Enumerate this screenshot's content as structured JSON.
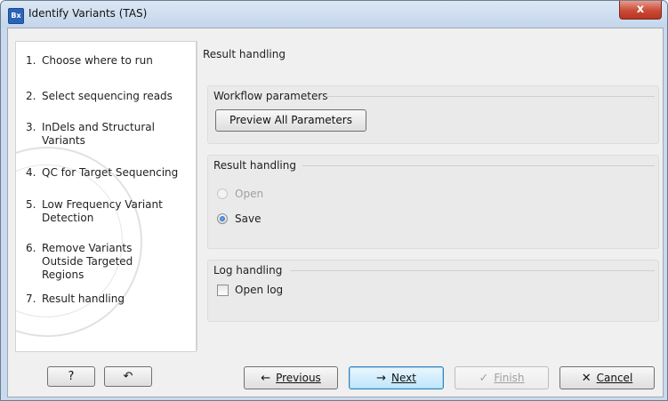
{
  "window": {
    "title": "Identify Variants (TAS)",
    "app_icon_text": "Bx",
    "close_glyph": "x"
  },
  "steps": [
    {
      "num": "1.",
      "label": "Choose where to run"
    },
    {
      "num": "2.",
      "label": "Select sequencing reads"
    },
    {
      "num": "3.",
      "label": "InDels and Structural Variants"
    },
    {
      "num": "4.",
      "label": "QC for Target Sequencing"
    },
    {
      "num": "5.",
      "label": "Low Frequency Variant Detection"
    },
    {
      "num": "6.",
      "label": "Remove Variants Outside Targeted Regions"
    },
    {
      "num": "7.",
      "label": "Result handling"
    }
  ],
  "content": {
    "heading": "Result handling",
    "workflow_params": {
      "title": "Workflow parameters",
      "preview_button": "Preview All Parameters"
    },
    "result_handling": {
      "title": "Result handling",
      "open_label": "Open",
      "save_label": "Save",
      "selected": "Save",
      "open_enabled": false
    },
    "log_handling": {
      "title": "Log handling",
      "open_log_label": "Open log",
      "open_log_checked": false
    }
  },
  "footer": {
    "help_glyph": "?",
    "reset_glyph": "↶",
    "previous_label": "Previous",
    "previous_icon": "←",
    "next_label": "Next",
    "next_icon": "→",
    "finish_label": "Finish",
    "finish_icon": "✓",
    "finish_enabled": false,
    "cancel_label": "Cancel",
    "cancel_icon": "✕"
  }
}
